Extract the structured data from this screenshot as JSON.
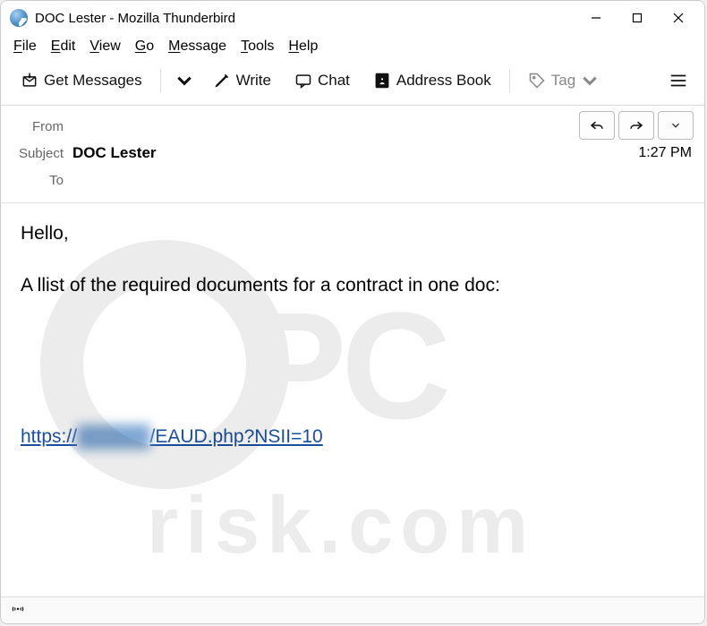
{
  "window": {
    "title": "DOC Lester - Mozilla Thunderbird"
  },
  "menu": {
    "file": "File",
    "edit": "Edit",
    "view": "View",
    "go": "Go",
    "message": "Message",
    "tools": "Tools",
    "help": "Help"
  },
  "toolbar": {
    "get_messages": "Get Messages",
    "write": "Write",
    "chat": "Chat",
    "address_book": "Address Book",
    "tag": "Tag"
  },
  "headers": {
    "from_label": "From",
    "from_value": "",
    "subject_label": "Subject",
    "subject_value": "DOC Lester",
    "to_label": "To",
    "to_value": "",
    "time": "1:27 PM"
  },
  "email_body": {
    "greeting": "Hello,",
    "line1": "A llist of the required documents for a contract in one doc:",
    "link_prefix": "https://",
    "link_hidden": "xxxxxxx",
    "link_suffix": "/EAUD.php?NSII=10"
  },
  "watermark": {
    "brand_top": "PC",
    "brand_bottom": "risk.com"
  }
}
